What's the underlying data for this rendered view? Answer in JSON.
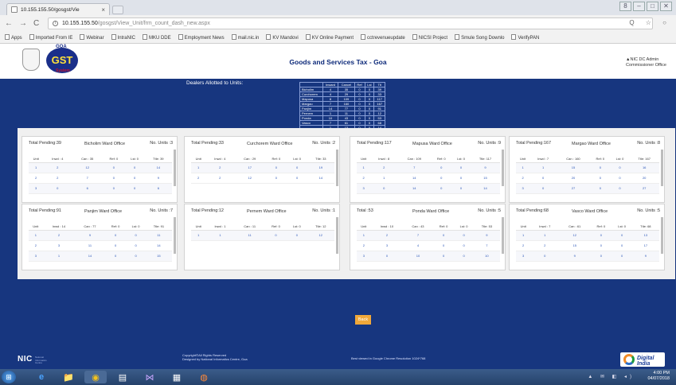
{
  "browser": {
    "tab_title": "10.155.155.50/gosgst/Vie",
    "tab_close": "×",
    "new_tab": "",
    "window_controls": [
      "8",
      "–",
      "□",
      "✕"
    ],
    "nav_back": "←",
    "nav_forward": "→",
    "nav_reload": "C",
    "address_host": "10.155.155.50",
    "address_path": "/gosgst/View_Unit/frm_count_dash_new.aspx",
    "addr_right_icons": "Q ☆ ○",
    "bookmarks": [
      "Apps",
      "Imported From IE",
      "Webinar",
      "IntraNIC",
      "MKU DDE",
      "Employment News",
      "mail.nic.in",
      "KV Mandovi",
      "KV Online Payment",
      "cctrevenueupdate",
      "NICSI Project",
      "Smule Song Downlo",
      "VerifyPAN"
    ]
  },
  "header": {
    "logo_text": "GST",
    "logo_goa": "GOA",
    "logo_system": "System",
    "title": "Goods and Services Tax - Goa",
    "user_line1": "▲NIC DC Admin",
    "user_line2": "Commissioner Office"
  },
  "dealers_title": "Dealers Allotted to Units:",
  "summary_table": {
    "headers": [
      "",
      "Inward",
      "Cancel",
      "Ref",
      "Lst",
      "Ttl"
    ],
    "rows": [
      [
        "Bicholim",
        "4",
        "35",
        "0",
        "0",
        "39"
      ],
      [
        "Curchorem",
        "4",
        "29",
        "0",
        "0",
        "33"
      ],
      [
        "Mapusa",
        "8",
        "109",
        "0",
        "0",
        "117"
      ],
      [
        "Margao",
        "7",
        "160",
        "0",
        "0",
        "167"
      ],
      [
        "Panjim",
        "14",
        "77",
        "0",
        "0",
        "91"
      ],
      [
        "Pernem",
        "1",
        "11",
        "0",
        "0",
        "12"
      ],
      [
        "Ponda",
        "10",
        "43",
        "0",
        "0",
        "53"
      ],
      [
        "Vasco",
        "7",
        "61",
        "0",
        "0",
        "68"
      ],
      [
        "",
        "1",
        "13",
        "0",
        "0",
        "14"
      ]
    ]
  },
  "cards": [
    {
      "total": "Total Pending:39",
      "office": "Bicholim Ward Office",
      "units": "No. Units :3",
      "headers": [
        "Unit",
        "Inwd : 4",
        "Can : 35",
        "Ref: 0",
        "Lst: 0",
        "Ttle: 39"
      ],
      "rows": [
        [
          "1",
          "2",
          "12",
          "0",
          "0",
          "14"
        ],
        [
          "2",
          "2",
          "7",
          "0",
          "0",
          "9"
        ],
        [
          "3",
          "0",
          "6",
          "0",
          "0",
          "6"
        ]
      ]
    },
    {
      "total": "Total Pending:33",
      "office": "Curchorem Ward Office",
      "units": "No. Units :2",
      "headers": [
        "Unit",
        "Inwd : 4",
        "Can : 29",
        "Ref: 0",
        "Lst: 0",
        "Ttle: 33"
      ],
      "rows": [
        [
          "1",
          "2",
          "17",
          "0",
          "0",
          "19"
        ],
        [
          "2",
          "2",
          "12",
          "0",
          "0",
          "14"
        ]
      ]
    },
    {
      "total": "Total Pending:117",
      "office": "Mapusa Ward Office",
      "units": "No. Units :9",
      "headers": [
        "Unit",
        "Inwd : 8",
        "Can : 109",
        "Ref: 0",
        "Lst: 0",
        "Ttle: 117"
      ],
      "rows": [
        [
          "1",
          "2",
          "7",
          "0",
          "0",
          "9"
        ],
        [
          "2",
          "1",
          "14",
          "0",
          "0",
          "15"
        ],
        [
          "3",
          "0",
          "14",
          "0",
          "0",
          "14"
        ]
      ]
    },
    {
      "total": "Total Pending:167",
      "office": "Margao Ward Office",
      "units": "No. Units :8",
      "headers": [
        "Unit",
        "Inwd : 7",
        "Can : 160",
        "Ref: 0",
        "Lst: 0",
        "Ttle: 167"
      ],
      "rows": [
        [
          "1",
          "1",
          "15",
          "0",
          "0",
          "16"
        ],
        [
          "2",
          "0",
          "20",
          "0",
          "0",
          "20"
        ],
        [
          "3",
          "0",
          "27",
          "0",
          "0",
          "27"
        ]
      ]
    },
    {
      "total": "Total Pending:91",
      "office": "Panjim Ward Office",
      "units": "No. Units :7",
      "headers": [
        "Unit",
        "Inwd : 14",
        "Can : 77",
        "Ref: 0",
        "Lst: 0",
        "Ttle: 91"
      ],
      "rows": [
        [
          "1",
          "2",
          "9",
          "0",
          "0",
          "11"
        ],
        [
          "2",
          "3",
          "11",
          "0",
          "0",
          "14"
        ],
        [
          "3",
          "1",
          "14",
          "0",
          "0",
          "15"
        ]
      ]
    },
    {
      "total": "Total Pending:12",
      "office": "Pernem Ward Office",
      "units": "No. Units :1",
      "headers": [
        "Unit",
        "Inwd : 1",
        "Can : 11",
        "Ref: 0",
        "Lst: 0",
        "Ttle: 12"
      ],
      "rows": [
        [
          "1",
          "1",
          "11",
          "0",
          "0",
          "12"
        ]
      ]
    },
    {
      "total": "Total :53",
      "office": "Ponda Ward Office",
      "units": "No. Units :5",
      "headers": [
        "Unit",
        "Inwd : 10",
        "Can : 43",
        "Ref: 0",
        "Lst: 0",
        "Ttle: 53"
      ],
      "rows": [
        [
          "1",
          "2",
          "7",
          "0",
          "0",
          "9"
        ],
        [
          "2",
          "3",
          "4",
          "0",
          "0",
          "7"
        ],
        [
          "3",
          "0",
          "10",
          "0",
          "0",
          "10"
        ]
      ]
    },
    {
      "total": "Total Pending:68",
      "office": "Vasco Ward Office",
      "units": "No. Units :5",
      "headers": [
        "Unit",
        "Inwd : 7",
        "Can : 61",
        "Ref: 0",
        "Lst: 0",
        "Ttle: 68"
      ],
      "rows": [
        [
          "1",
          "1",
          "12",
          "0",
          "0",
          "13"
        ],
        [
          "2",
          "2",
          "15",
          "0",
          "0",
          "17"
        ],
        [
          "3",
          "0",
          "9",
          "0",
          "0",
          "9"
        ]
      ]
    }
  ],
  "back_button": "Back",
  "footer": {
    "nic": "NIC",
    "nic_sub": "National Informatics Centre",
    "copyright_line1": "Copyright©All Rights Reserved",
    "copyright_line2": "Designed by National Informatics Centre, Goa",
    "resolution": "Best viewed in Google Chrome Resolution 1024*768",
    "digital_india": "Digital India"
  },
  "taskbar": {
    "start": "⊞",
    "apps": [
      "e",
      "📁",
      "◉",
      "▤",
      "⋈",
      "▦",
      "◍"
    ],
    "tray_icons": "▲ ✉ ◧ ◂)",
    "time": "4:00 PM",
    "date": "04/07/2018"
  }
}
